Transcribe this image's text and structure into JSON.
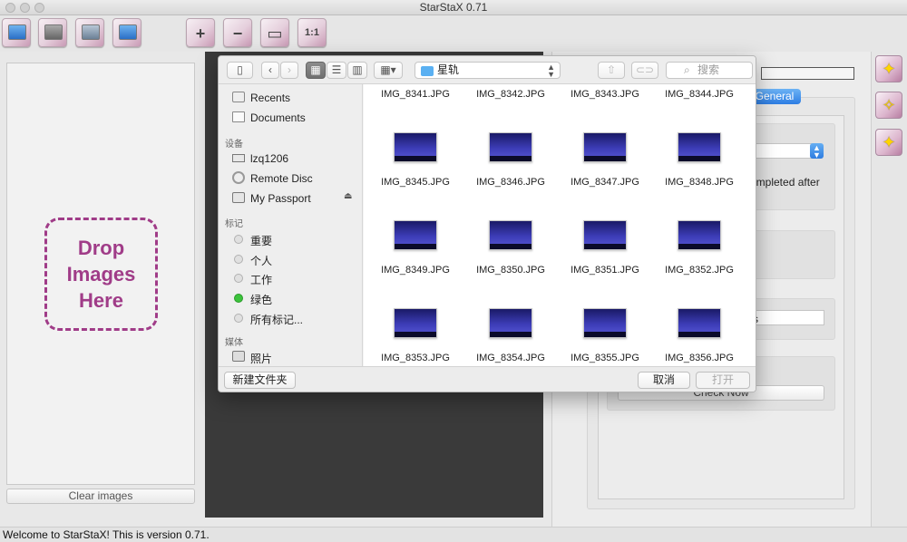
{
  "window": {
    "title": "StarStaX 0.71"
  },
  "toolbar": {
    "buttons": [
      {
        "name": "open-images-button",
        "icon": "folder-open-icon"
      },
      {
        "name": "open-dark-frames-button",
        "icon": "dark-frame-icon"
      },
      {
        "name": "save-image-button",
        "icon": "save-icon"
      },
      {
        "name": "save-as-button",
        "icon": "save-as-icon"
      },
      {
        "name": "zoom-in-button",
        "icon": "zoom-in-icon",
        "glyph": "+"
      },
      {
        "name": "zoom-out-button",
        "icon": "zoom-out-icon",
        "glyph": "−"
      },
      {
        "name": "fit-window-button",
        "icon": "fit-window-icon",
        "glyph": "▭"
      },
      {
        "name": "actual-size-button",
        "icon": "actual-size-icon",
        "glyph": "1:1"
      }
    ]
  },
  "left_panel": {
    "drop_text": "Drop\nImages\nHere",
    "clear_button": "Clear images"
  },
  "settings": {
    "general_tab": "General",
    "completed_label": "ompleted after",
    "s_field_text": "s",
    "check_now": "Check Now"
  },
  "status_bar": {
    "text": "Welcome to StarStaX! This is version 0.71."
  },
  "dialog": {
    "path": "星轨",
    "search_placeholder": "搜索",
    "sidebar": {
      "favorites": [
        {
          "label": "Recents",
          "icon": "recents-icon"
        },
        {
          "label": "Documents",
          "icon": "documents-icon"
        }
      ],
      "devices_header": "设备",
      "devices": [
        {
          "label": "lzq1206",
          "icon": "computer-icon"
        },
        {
          "label": "Remote Disc",
          "icon": "disc-icon"
        },
        {
          "label": "My Passport",
          "icon": "drive-icon"
        }
      ],
      "tags_header": "标记",
      "tags": [
        {
          "label": "重要",
          "color": "#e0e0e0"
        },
        {
          "label": "个人",
          "color": "#e0e0e0"
        },
        {
          "label": "工作",
          "color": "#e0e0e0"
        },
        {
          "label": "绿色",
          "color": "#3cc33c"
        },
        {
          "label": "所有标记...",
          "color": "#e0e0e0"
        }
      ],
      "media_header": "媒体",
      "media": [
        {
          "label": "照片",
          "icon": "camera-icon"
        }
      ]
    },
    "files": [
      "IMG_8341.JPG",
      "IMG_8342.JPG",
      "IMG_8343.JPG",
      "IMG_8344.JPG",
      "IMG_8345.JPG",
      "IMG_8346.JPG",
      "IMG_8347.JPG",
      "IMG_8348.JPG",
      "IMG_8349.JPG",
      "IMG_8350.JPG",
      "IMG_8351.JPG",
      "IMG_8352.JPG",
      "IMG_8353.JPG",
      "IMG_8354.JPG",
      "IMG_8355.JPG",
      "IMG_8356.JPG"
    ],
    "new_folder_button": "新建文件夹",
    "cancel_button": "取消",
    "open_button": "打开"
  }
}
